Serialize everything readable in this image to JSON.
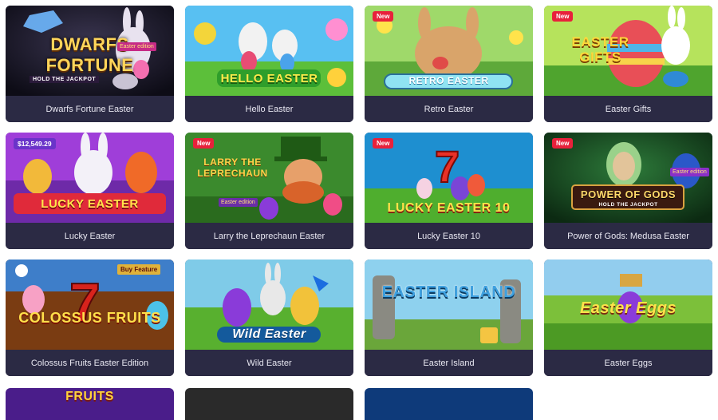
{
  "games": [
    {
      "title": "Dwarfs Fortune Easter",
      "logo": "DWARFS FORTUNE",
      "sublogo": "HOLD THE JACKPOT",
      "tag": "Easter edition",
      "badge": ""
    },
    {
      "title": "Hello Easter",
      "logo": "HELLO EASTER",
      "badge": ""
    },
    {
      "title": "Retro Easter",
      "logo": "RETRO EASTER",
      "badge": "New"
    },
    {
      "title": "Easter Gifts",
      "logo": "EASTER GIFTS",
      "badge": "New"
    },
    {
      "title": "Lucky Easter",
      "logo": "LUCKY EASTER",
      "badge": "",
      "jackpot": "$12,549.29"
    },
    {
      "title": "Larry the Leprechaun Easter",
      "logo": "LARRY THE LEPRECHAUN",
      "tag": "Easter edition",
      "badge": "New"
    },
    {
      "title": "Lucky Easter 10",
      "logo": "LUCKY EASTER 10",
      "badge": "New"
    },
    {
      "title": "Power of Gods: Medusa Easter",
      "logo": "POWER OF GODS",
      "sublogo": "HOLD THE JACKPOT",
      "tag": "Easter edition",
      "badge": "New"
    },
    {
      "title": "Colossus Fruits Easter Edition",
      "logo": "COLOSSUS FRUITS",
      "tag": "Buy Feature",
      "badge": ""
    },
    {
      "title": "Wild Easter",
      "logo": "Wild Easter",
      "badge": ""
    },
    {
      "title": "Easter Island",
      "logo": "EASTER ISLAND",
      "badge": ""
    },
    {
      "title": "Easter Eggs",
      "logo": "Easter Eggs",
      "badge": ""
    }
  ],
  "partial_logo": "FRUITS"
}
